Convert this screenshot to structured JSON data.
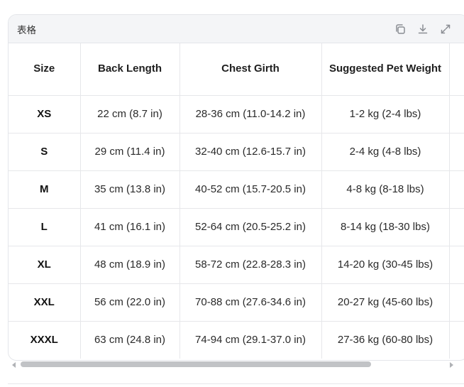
{
  "card": {
    "title": "表格"
  },
  "toolbar": {
    "copy_icon": "copy-icon",
    "download_icon": "download-icon",
    "expand_icon": "expand-icon"
  },
  "table": {
    "headers": [
      "Size",
      "Back Length",
      "Chest Girth",
      "Suggested Pet Weight",
      ""
    ],
    "rows": [
      [
        "XS",
        "22 cm (8.7 in)",
        "28-36 cm (11.0-14.2 in)",
        "1-2 kg (2-4 lbs)",
        ""
      ],
      [
        "S",
        "29 cm (11.4 in)",
        "32-40 cm (12.6-15.7 in)",
        "2-4 kg (4-8 lbs)",
        ""
      ],
      [
        "M",
        "35 cm (13.8 in)",
        "40-52 cm (15.7-20.5 in)",
        "4-8 kg (8-18 lbs)",
        ""
      ],
      [
        "L",
        "41 cm (16.1 in)",
        "52-64 cm (20.5-25.2 in)",
        "8-14 kg (18-30 lbs)",
        ""
      ],
      [
        "XL",
        "48 cm (18.9 in)",
        "58-72 cm (22.8-28.3 in)",
        "14-20 kg (30-45 lbs)",
        ""
      ],
      [
        "XXL",
        "56 cm (22.0 in)",
        "70-88 cm (27.6-34.6 in)",
        "20-27 kg (45-60 lbs)",
        ""
      ],
      [
        "XXXL",
        "63 cm (24.8 in)",
        "74-94 cm (29.1-37.0 in)",
        "27-36 kg (60-80 lbs)",
        ""
      ]
    ]
  }
}
